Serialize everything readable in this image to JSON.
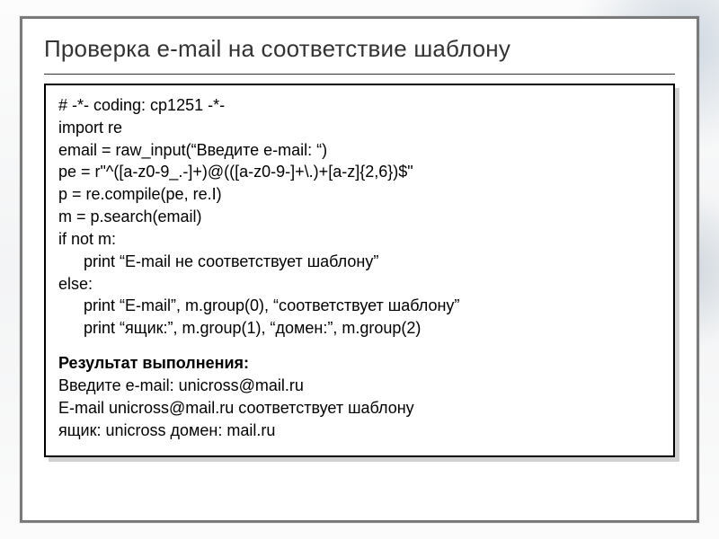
{
  "slide": {
    "title": "Проверка e-mail на соответствие шаблону"
  },
  "code": {
    "l1": "# -*- coding: cp1251 -*-",
    "l2": "import re",
    "l3": "email = raw_input(“Введите e-mail: “)",
    "l4": "pe = r\"^([a-z0-9_.-]+)@(([a-z0-9-]+\\.)+[a-z]{2,6})$\"",
    "l5": "p = re.compile(pe, re.I)",
    "l6": "m = p.search(email)",
    "l7": "if not m:",
    "l8": "print “E-mail не соответствует шаблону”",
    "l9": "else:",
    "l10": "print “E-mail”, m.group(0), “соответствует шаблону”",
    "l11": "print “ящик:”, m.group(1), “домен:”, m.group(2)"
  },
  "result": {
    "heading": "Результат выполнения:",
    "r1": "Введите e-mail: unicross@mail.ru",
    "r2": "E-mail unicross@mail.ru соответствует шаблону",
    "r3": "ящик: unicross домен: mail.ru"
  }
}
